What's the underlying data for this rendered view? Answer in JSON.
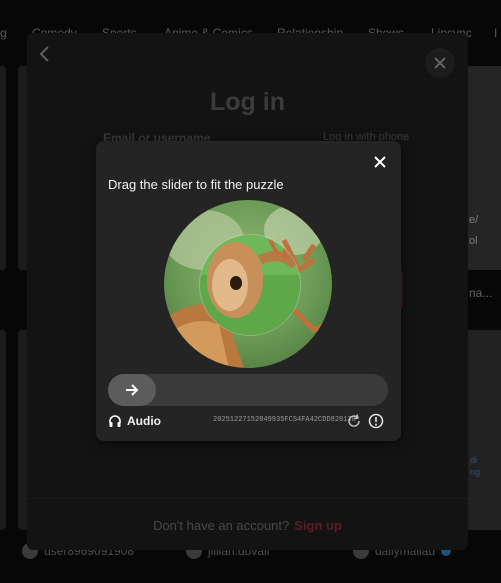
{
  "categories": [
    "g",
    "Comedy",
    "Sports",
    "Anime & Comics",
    "Relationship",
    "Shows",
    "Lipsync",
    "I"
  ],
  "login": {
    "title": "Log in",
    "email_label": "Email or username",
    "phone_link": "Log in with phone",
    "footer_text": "Don't have an account?",
    "signup_label": "Sign up"
  },
  "captcha": {
    "title": "Drag the slider to fit the puzzle",
    "audio_label": "Audio",
    "request_id": "20251227152849935FCS4FA42CDD828138",
    "slider_position": 0
  },
  "background": {
    "right_snippet_1": "e/",
    "right_snippet_2": "ol",
    "right_snippet_3": "na...",
    "right_snippet_4": "di",
    "right_snippet_5": "ng",
    "users": [
      "user8969091908",
      "jillian.duvall",
      "dailymallau"
    ]
  }
}
